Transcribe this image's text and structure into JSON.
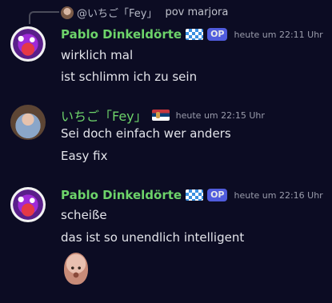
{
  "reply": {
    "name": "@いちご「Fey」",
    "text": "pov marjora"
  },
  "messages": [
    {
      "author": "Pablo Dinkeldörte",
      "badge": "OP",
      "timestamp": "heute um 22:11 Uhr",
      "lines": [
        "wirklich mal",
        "ist schlimm ich zu sein"
      ]
    },
    {
      "author": "いちご「Fey」",
      "timestamp": "heute um 22:15 Uhr",
      "lines": [
        "Sei doch einfach wer anders",
        "Easy fix"
      ]
    },
    {
      "author": "Pablo Dinkeldörte",
      "badge": "OP",
      "timestamp": "heute um 22:16 Uhr",
      "lines": [
        "scheiße",
        "das ist so unendlich intelligent"
      ]
    }
  ],
  "colors": {
    "background": "#0c0c23",
    "username": "#6dd36a",
    "badge": "#5865f2",
    "timestamp": "#9a9cab"
  },
  "icons": {
    "flag_1": "bavaria-flag-icon",
    "flag_2": "serbia-flag-icon",
    "emoji": "bald-head-emoji"
  }
}
